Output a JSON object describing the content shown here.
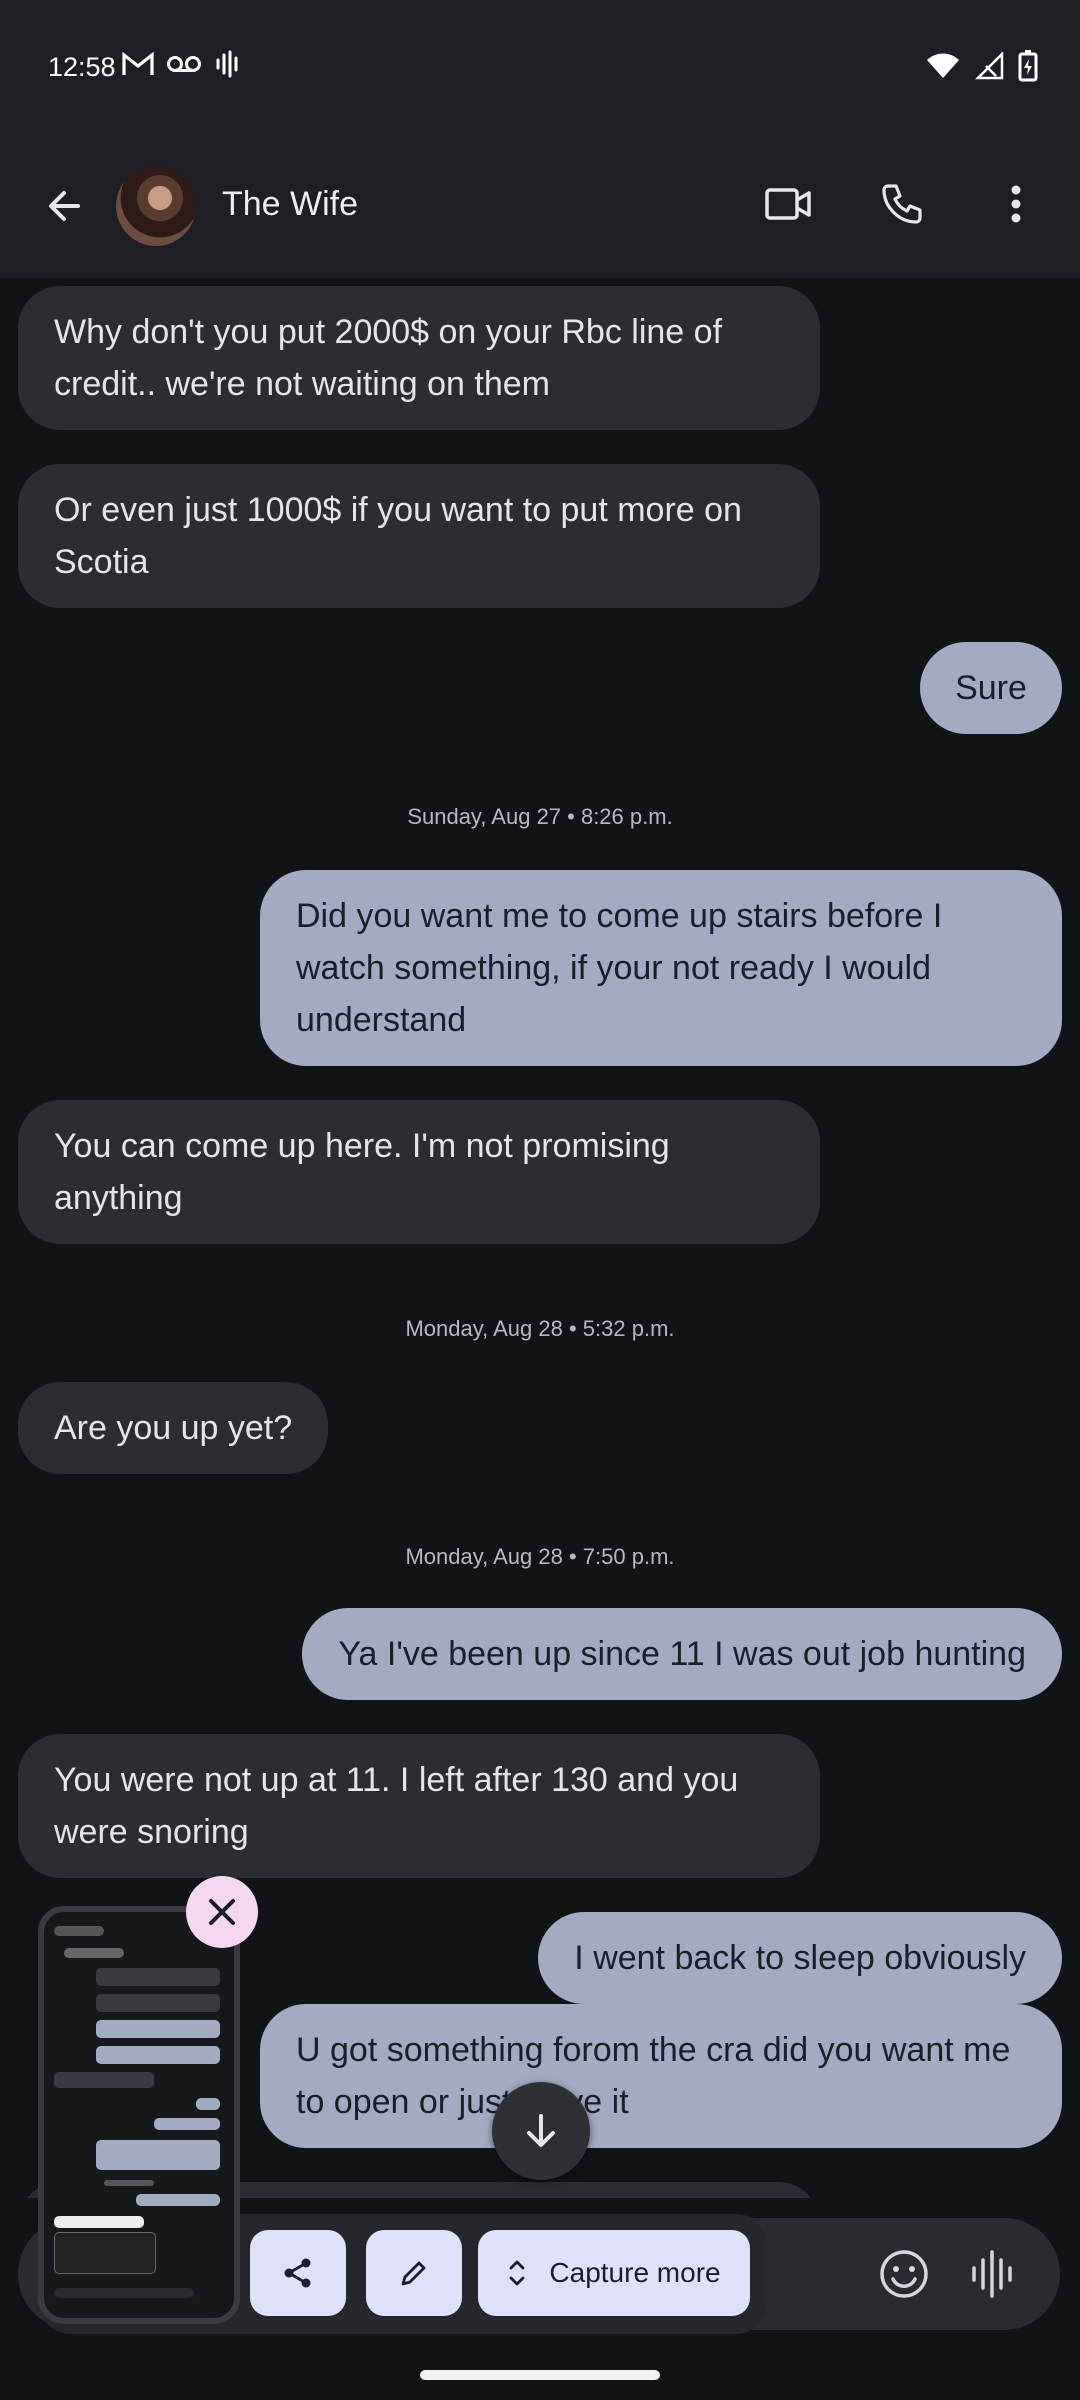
{
  "status_bar": {
    "time": "12:58",
    "left_icons": [
      "gmail-icon",
      "voicemail-icon",
      "sound-wave-icon"
    ],
    "right_icons": [
      "wifi-icon",
      "signal-icon",
      "battery-charging-icon"
    ]
  },
  "app_bar": {
    "contact_name": "The Wife",
    "actions": [
      "video-call-icon",
      "phone-icon",
      "more-vert-icon"
    ]
  },
  "conversation": {
    "messages": [
      {
        "id": "m1",
        "direction": "incoming",
        "text": "Why don't you put 2000$ on your Rbc line of credit.. we're not waiting on them"
      },
      {
        "id": "m2",
        "direction": "incoming",
        "text": "Or even just 1000$ if you want to put more on Scotia"
      },
      {
        "id": "m3",
        "direction": "outgoing",
        "text": "Sure"
      },
      {
        "id": "d1",
        "type": "date",
        "text": "Sunday, Aug 27 • 8:26 p.m."
      },
      {
        "id": "m4",
        "direction": "outgoing",
        "text": "Did you want me to come up stairs before I watch something, if your not ready I would understand"
      },
      {
        "id": "m5",
        "direction": "incoming",
        "text": "You can come up here. I'm not promising anything"
      },
      {
        "id": "d2",
        "type": "date",
        "text": "Monday, Aug 28 • 5:32 p.m."
      },
      {
        "id": "m6",
        "direction": "incoming",
        "text": "Are you up yet?"
      },
      {
        "id": "d3",
        "type": "date",
        "text": "Monday, Aug 28 • 7:50 p.m."
      },
      {
        "id": "m7",
        "direction": "outgoing",
        "text": "Ya I've been up since 11 I was out job hunting"
      },
      {
        "id": "m8",
        "direction": "incoming",
        "text": "You were not up at 11. I left after 130 and you were snoring"
      },
      {
        "id": "m9",
        "direction": "outgoing",
        "text": "I went back to sleep obviously"
      },
      {
        "id": "m10",
        "direction": "outgoing",
        "text": "U got something forom the cra did you want me to open or just leave it"
      }
    ]
  },
  "screenshot_toolbar": {
    "share_icon": "share-icon",
    "edit_icon": "pencil-icon",
    "capture_more_label": "Capture more",
    "capture_more_icon": "expand-vertical-icon",
    "close_icon": "close-icon"
  },
  "compose": {
    "emoji_icon": "emoji-icon",
    "voice_icon": "voice-wave-icon"
  },
  "scroll_down_icon": "arrow-down-icon",
  "colors": {
    "background": "#121317",
    "incoming_bubble": "#2c2d32",
    "outgoing_bubble": "#a4aac1",
    "capture_button": "#dfe1f8",
    "close_badge": "#f5d7f2"
  }
}
